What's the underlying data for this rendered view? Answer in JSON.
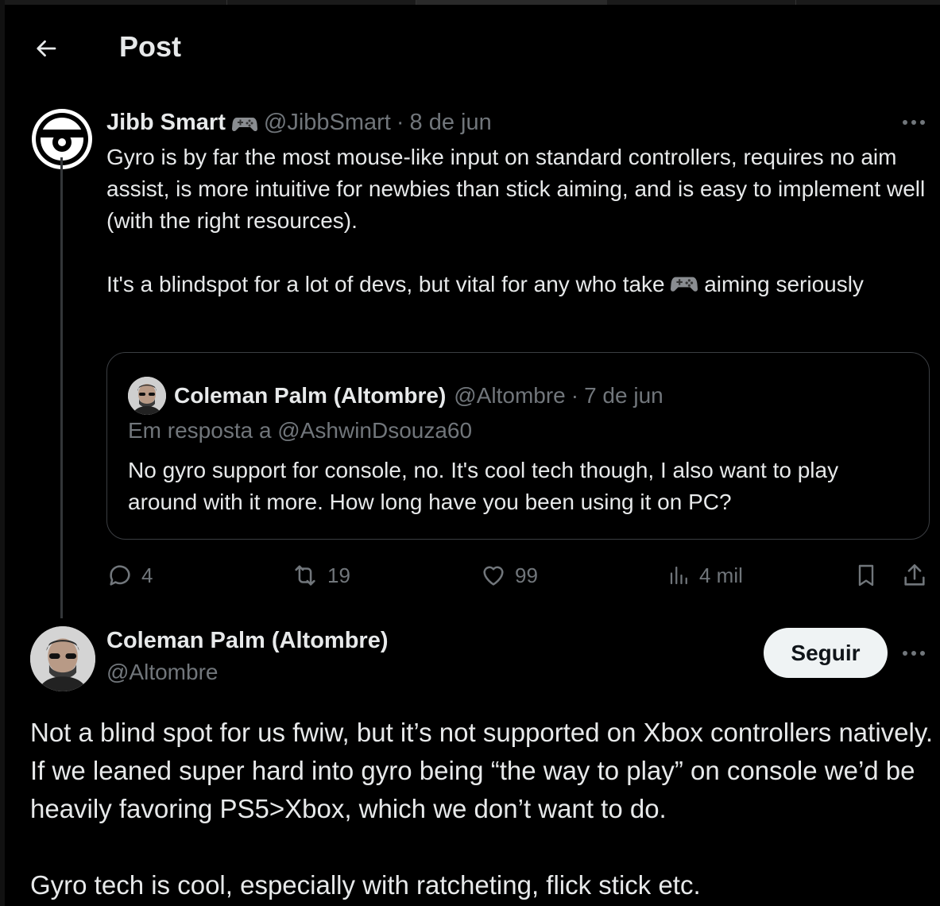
{
  "header": {
    "title": "Post"
  },
  "main_tweet": {
    "author_name": "Jibb Smart",
    "handle": "@JibbSmart",
    "separator": "·",
    "date": "8 de jun",
    "badge_icon": "gamepad-emoji",
    "body_paragraph_1": "Gyro is by far the most mouse-like input on standard controllers, requires no aim assist, is more intuitive for newbies than stick aiming, and is easy to implement well (with the right resources).",
    "body_paragraph_2_before": "It's a blindspot for a lot of devs, but vital for any who take",
    "body_paragraph_2_after": "aiming seriously"
  },
  "quoted_tweet": {
    "author_name": "Coleman Palm (Altombre)",
    "handle": "@Altombre",
    "separator": "·",
    "date": "7 de jun",
    "reply_to": "Em resposta a @AshwinDsouza60",
    "body": "No gyro support for console, no. It's cool tech though, I also want to play around with it more. How long have you been using it on PC?"
  },
  "actions": {
    "replies": "4",
    "reposts": "19",
    "likes": "99",
    "views": "4 mil"
  },
  "reply_tweet": {
    "author_name": "Coleman Palm (Altombre)",
    "handle": "@Altombre",
    "follow_label": "Seguir",
    "body_paragraph_1": "Not a blind spot for us fwiw, but it’s not supported on Xbox controllers natively. If we leaned super hard into gyro being “the way to play” on console we’d be heavily favoring PS5>Xbox, which we don’t want to do.",
    "body_paragraph_2": "Gyro tech is cool, especially with ratcheting, flick stick etc."
  },
  "colors": {
    "background": "#000000",
    "text_primary": "#e7e9ea",
    "text_muted": "#71767b",
    "border": "#3b3e42",
    "follow_button_bg": "#eff3f4"
  }
}
